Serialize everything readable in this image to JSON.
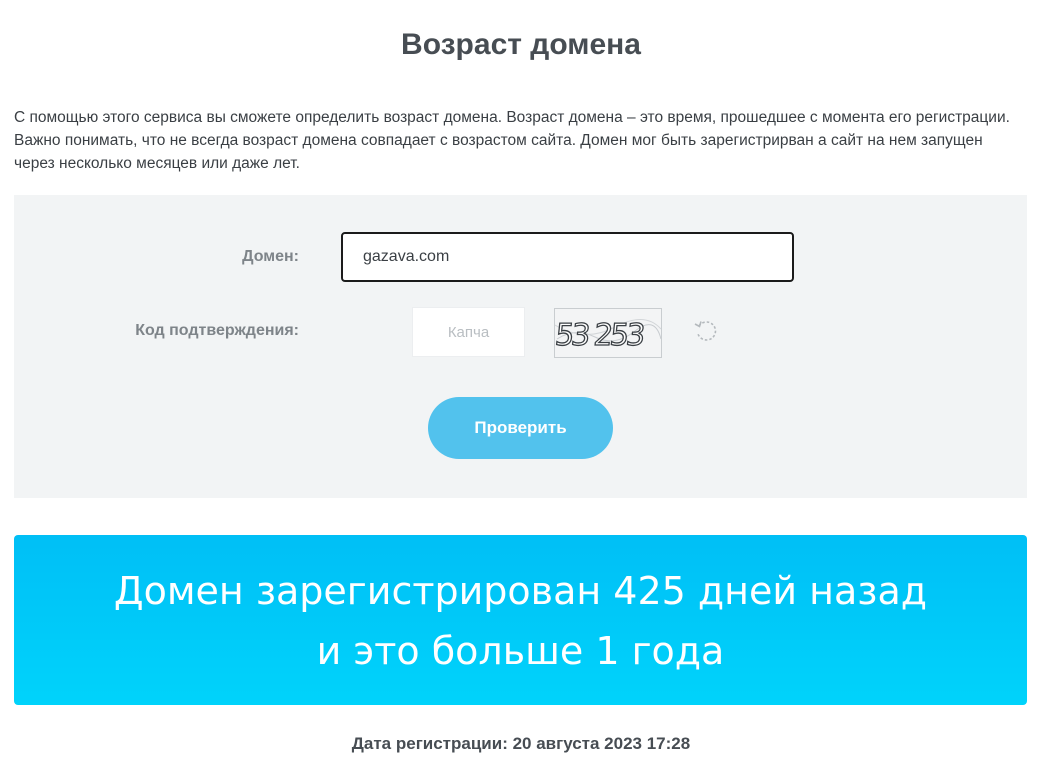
{
  "page": {
    "title": "Возраст домена",
    "intro": "С помощью этого сервиса вы сможете определить возраст домена. Возраст домена – это время, прошедшее с момента его регистрации. Важно понимать, что не всегда возраст домена совпадает с возрастом сайта. Домен мог быть зарегистрирван а сайт на нем запущен через несколько месяцев или даже лет."
  },
  "form": {
    "domain_label": "Домен:",
    "domain_value": "gazava.com",
    "captcha_label": "Код подтверждения:",
    "captcha_placeholder": "Капча",
    "captcha_image_text": "53 253",
    "refresh_icon": "refresh-icon",
    "submit_label": "Проверить"
  },
  "result": {
    "line1": "Домен зарегистрирован 425 дней назад",
    "line2": "и это больше 1 года",
    "registration_date": "Дата регистрации: 20 августа 2023 17:28"
  },
  "colors": {
    "accent_button": "#52c2ed",
    "banner_top": "#00bff6",
    "banner_bottom": "#00d3fb",
    "panel_background": "#f2f4f5"
  }
}
